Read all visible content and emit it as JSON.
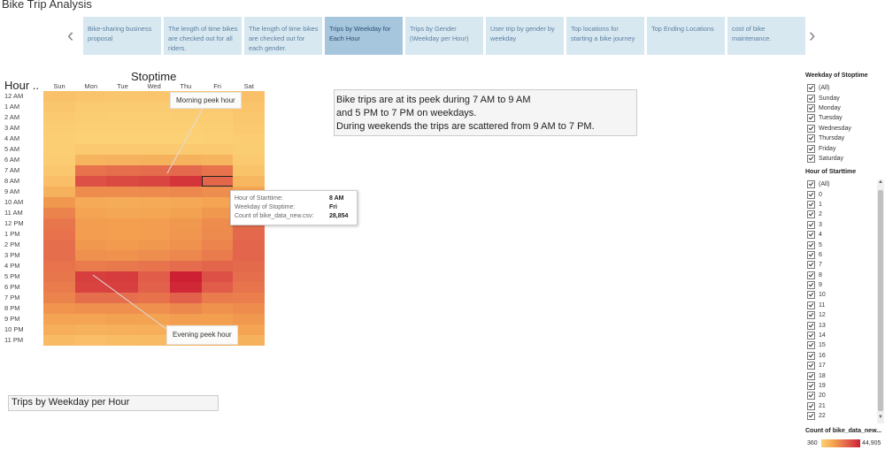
{
  "title": "Bike Trip Analysis",
  "story": {
    "prev_icon": "chevron-left-icon",
    "next_icon": "chevron-right-icon",
    "points": [
      {
        "label": "Bike-sharing business proposal",
        "active": false
      },
      {
        "label": "The length of time bikes are checked out for all riders.",
        "active": false
      },
      {
        "label": "The length of time bikes are checked out for each gender.",
        "active": false
      },
      {
        "label": "Trips by Weekday for Each Hour",
        "active": true
      },
      {
        "label": "Trips by Gender (Weekday per Hour)",
        "active": false
      },
      {
        "label": "User trip by gender by weekday",
        "active": false
      },
      {
        "label": "Top locations for starting a bike journey",
        "active": false
      },
      {
        "label": "Top Ending Locations",
        "active": false
      },
      {
        "label": "cost of bike maintenance.",
        "active": false
      }
    ]
  },
  "heatmap": {
    "row_header": "Hour ..",
    "column_header": "Stoptime",
    "selected": {
      "hour_index": 8,
      "day_index": 5
    }
  },
  "chart_data": {
    "type": "heatmap",
    "x": [
      "Sun",
      "Mon",
      "Tue",
      "Wed",
      "Thu",
      "Fri",
      "Sat"
    ],
    "y": [
      "12 AM",
      "1 AM",
      "2 AM",
      "3 AM",
      "4 AM",
      "5 AM",
      "6 AM",
      "7 AM",
      "8 AM",
      "9 AM",
      "10 AM",
      "11 AM",
      "12 PM",
      "1 PM",
      "2 PM",
      "3 PM",
      "4 PM",
      "5 PM",
      "6 PM",
      "7 PM",
      "8 PM",
      "9 PM",
      "10 PM",
      "11 PM"
    ],
    "values": [
      [
        5000,
        4000,
        3500,
        3800,
        4200,
        4500,
        5200
      ],
      [
        3500,
        2000,
        1800,
        1900,
        2100,
        2400,
        4200
      ],
      [
        2500,
        1200,
        1000,
        1100,
        1200,
        1500,
        3200
      ],
      [
        1500,
        700,
        600,
        650,
        700,
        900,
        2200
      ],
      [
        1000,
        500,
        400,
        450,
        500,
        700,
        1500
      ],
      [
        900,
        2500,
        2400,
        2500,
        2600,
        2600,
        1200
      ],
      [
        1500,
        9000,
        9500,
        9800,
        10000,
        9000,
        2500
      ],
      [
        3000,
        26000,
        27000,
        27500,
        28500,
        26000,
        4500
      ],
      [
        6000,
        34000,
        35500,
        36500,
        40000,
        28854,
        8000
      ],
      [
        10000,
        20000,
        20000,
        20500,
        21000,
        19500,
        13000
      ],
      [
        17000,
        12000,
        11500,
        12000,
        12500,
        14000,
        19000
      ],
      [
        22000,
        14000,
        13000,
        13500,
        14500,
        17000,
        24000
      ],
      [
        25000,
        16000,
        15500,
        16000,
        17000,
        20000,
        27000
      ],
      [
        26000,
        16000,
        15500,
        16000,
        17500,
        20500,
        28500
      ],
      [
        27000,
        17000,
        16500,
        17000,
        18500,
        21500,
        29000
      ],
      [
        27000,
        19000,
        18500,
        19500,
        21000,
        24000,
        29000
      ],
      [
        26000,
        24000,
        24500,
        25500,
        27500,
        29000,
        28000
      ],
      [
        25000,
        38000,
        38500,
        31000,
        44905,
        34000,
        27000
      ],
      [
        24000,
        37000,
        37500,
        30000,
        43000,
        31000,
        25500
      ],
      [
        22000,
        27000,
        27000,
        26000,
        30000,
        24000,
        23000
      ],
      [
        18000,
        19000,
        19000,
        19000,
        21000,
        18500,
        20000
      ],
      [
        14000,
        14000,
        14500,
        14500,
        16000,
        15500,
        17000
      ],
      [
        11000,
        10000,
        10500,
        11000,
        12000,
        13500,
        14000
      ],
      [
        7000,
        6000,
        6500,
        7000,
        8000,
        10500,
        10000
      ]
    ],
    "color_min": 360,
    "color_max": 44905,
    "color_stops": [
      "#fcd075",
      "#f3a04f",
      "#e2614b",
      "#cd2033"
    ]
  },
  "annotations": {
    "morning": "Morning peek hour",
    "evening": "Evening peek hour"
  },
  "tooltip": {
    "rows": [
      {
        "key": "Hour of Starttime:",
        "value": "8 AM"
      },
      {
        "key": "Weekday of Stoptime:",
        "value": "Fri"
      },
      {
        "key": "Count of bike_data_new.csv:",
        "value": "28,854"
      }
    ]
  },
  "caption": {
    "line1": "Bike trips are at its peek during 7 AM to 9 AM",
    "line2": "and 5 PM to 7 PM on weekdays.",
    "line3": "During weekends the trips are scattered from 9 AM to 7 PM."
  },
  "sheet_title": "Trips by Weekday per Hour",
  "filters": {
    "weekday": {
      "title": "Weekday of Stoptime",
      "items": [
        "(All)",
        "Sunday",
        "Monday",
        "Tuesday",
        "Wednesday",
        "Thursday",
        "Friday",
        "Saturday"
      ]
    },
    "hour": {
      "title": "Hour of Starttime",
      "items": [
        "(All)",
        "0",
        "1",
        "2",
        "3",
        "4",
        "5",
        "6",
        "7",
        "8",
        "9",
        "10",
        "11",
        "12",
        "13",
        "14",
        "15",
        "16",
        "17",
        "18",
        "19",
        "20",
        "21",
        "22"
      ],
      "scroll_up_icon": "scroll-up-arrow-icon",
      "scroll_down_icon": "scroll-down-arrow-icon"
    }
  },
  "legend": {
    "title": "Count of bike_data_new...",
    "min": "360",
    "max": "44,905"
  }
}
